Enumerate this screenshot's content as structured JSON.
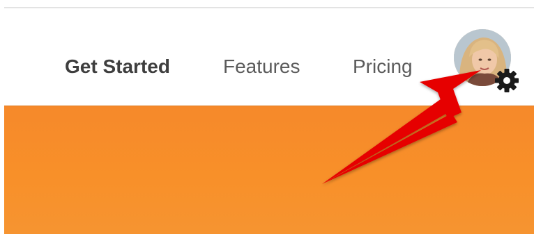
{
  "nav": {
    "items": [
      {
        "label": "Get Started"
      },
      {
        "label": "Features"
      },
      {
        "label": "Pricing"
      }
    ]
  },
  "avatar": {
    "icon": "user-photo",
    "badge_icon": "gear-icon"
  },
  "banner": {
    "color": "#f68b2a"
  },
  "annotation": {
    "icon": "red-arrow",
    "color": "#e60000"
  }
}
